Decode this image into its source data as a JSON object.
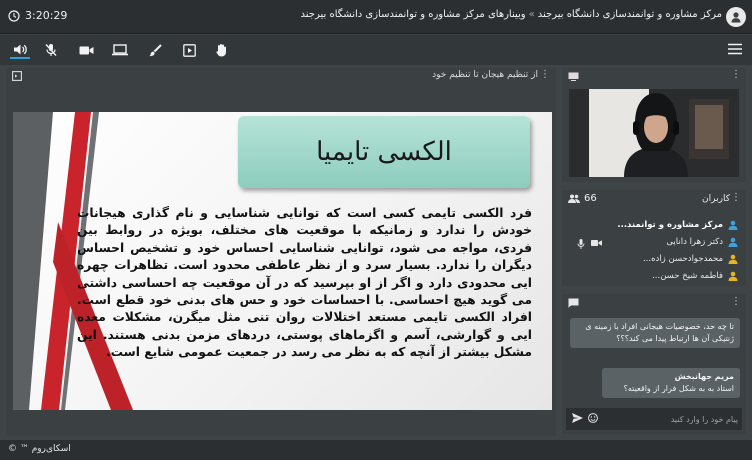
{
  "clock": {
    "time": "3:20:29"
  },
  "breadcrumb": {
    "parent": "مرکز مشاوره و توانمندسازی دانشگاه بیرجند",
    "separator": "»",
    "current": "وبینارهای مرکز مشاوره و توانمندسازی دانشگاه بیرجند"
  },
  "toolbar": {
    "icons": [
      "speaker-icon",
      "mic-muted-icon",
      "camera-icon",
      "screen-share-icon",
      "brush-icon",
      "media-play-icon",
      "raise-hand-icon",
      "menu-icon"
    ],
    "active": "speaker-icon",
    "accent": "#29a3d6"
  },
  "presentation": {
    "panel_title": "از تنظیم هیجان تا تنظیم خود",
    "slide_title": "الکسی تایمیا",
    "slide_body": "فرد الکسی تایمی کسی است که توانایی شناسایی و نام گذاری هیجانات خودش را ندارد و زمانیکه با موقعیت های مختلف، بویژه در روابط بین فردی، مواجه می شود، توانایی شناسایی احساس خود و تشخیص احساس دیگران را ندارد. بسیار سرد و از نظر عاطفی محدود است. تظاهرات چهره ایی محدودی دارد و اگر از او بپرسید که در آن موقعیت چه احساسی داشتی می گوید هیچ احساسی. با احساسات خود و حس های بدنی خود قطع است. افراد الکسی تایمی مستعد اختلالات روان تنی مثل میگرن، مشکلات معده ایی و گوارشی، آسم و اگزماهای پوستی، دردهای مزمن بدنی هستند. این مشکل بیشتر از آنچه که به نظر می رسد در جمعیت عمومی شایع است."
  },
  "users": {
    "title": "کاربران",
    "count": "66",
    "items": [
      {
        "name": "مرکز مشاوره و توانمند...",
        "role": "presenter"
      },
      {
        "name": "دکتر زهرا دانایی",
        "role": "user"
      },
      {
        "name": "محمدجوادحسن زاده...",
        "role": "user-badge"
      },
      {
        "name": "فاطمه شیخ حسن...",
        "role": "user"
      }
    ]
  },
  "chat": {
    "messages": [
      {
        "author": "",
        "text": "تا چه حد، خصوصیات هیجانی افراد با زمینه ی ژنتیکی آن ها ارتباط پیدا می کند؟؟؟"
      },
      {
        "author": "مریم جهانبخش",
        "text": "استاد به به شکل فرار از واقعیته؟"
      }
    ],
    "placeholder": "پیام خود را وارد کنید"
  },
  "footer": {
    "brand": "اسکای‌روم ™",
    "copyright": "©"
  }
}
